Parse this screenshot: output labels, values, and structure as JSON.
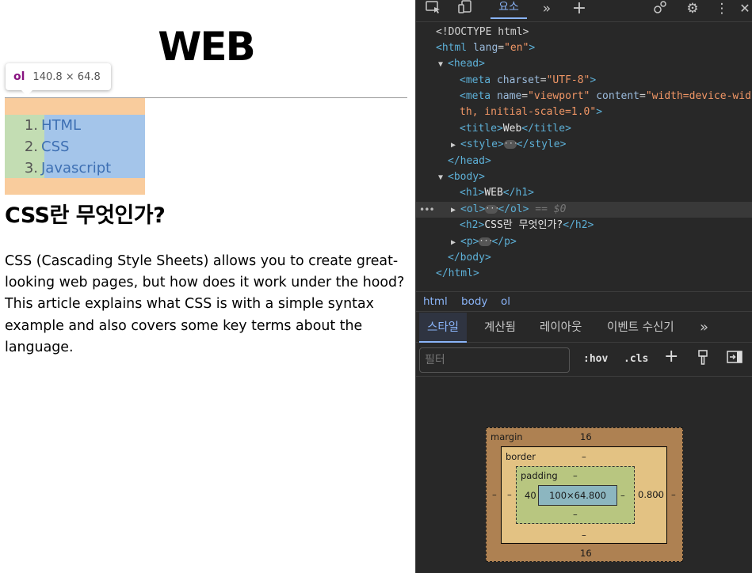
{
  "page": {
    "title": "WEB",
    "list_items": [
      {
        "num": "1.",
        "text": "HTML"
      },
      {
        "num": "2.",
        "text": "CSS"
      },
      {
        "num": "3.",
        "text": "Javascript"
      }
    ],
    "heading2": "CSS란 무엇인가?",
    "paragraph": "CSS (Cascading Style Sheets) allows you to create great-looking web pages, but how does it work under the hood? This article explains what CSS is with a simple syntax example and also covers some key terms about the language."
  },
  "tooltip": {
    "tag": "ol",
    "dimensions": "140.8 × 64.8"
  },
  "devtools": {
    "toolbar": {
      "elements_tab": "요소"
    },
    "dom": {
      "doctype": "<!DOCTYPE html>",
      "html_open": "<html",
      "html_attr_name": "lang",
      "html_attr_value": "\"en\"",
      "head_open": "<head>",
      "meta1_tag": "<meta",
      "meta1_attr": "charset",
      "meta1_val": "\"UTF-8\"",
      "meta2_tag": "<meta",
      "meta2_attr1": "name",
      "meta2_val1": "\"viewport\"",
      "meta2_attr2": "content",
      "meta2_val2a": "\"width=device-wid",
      "meta2_val2b": "th, initial-scale=1.0\"",
      "title_open": "<title>",
      "title_text": "Web",
      "title_close": "</title>",
      "style_open": "<style>",
      "style_close": "</style>",
      "head_close": "</head>",
      "body_open": "<body>",
      "h1_open": "<h1>",
      "h1_text": "WEB",
      "h1_close": "</h1>",
      "ol_open": "<ol>",
      "ol_close": "</ol>",
      "selected_marker": "== $0",
      "h2_open": "<h2>",
      "h2_text": "CSS란 무엇인가?",
      "h2_close": "</h2>",
      "p_open": "<p>",
      "p_close": "</p>",
      "body_close": "</body>",
      "html_close": "</html>"
    },
    "breadcrumb": [
      "html",
      "body",
      "ol"
    ],
    "style_tabs": [
      "스타일",
      "계산됨",
      "레이아웃",
      "이벤트 수신기"
    ],
    "filter": {
      "placeholder": "필터",
      "hov": ":hov",
      "cls": ".cls"
    },
    "box_model": {
      "margin_label": "margin",
      "margin_top": "16",
      "margin_bottom": "16",
      "margin_left": "–",
      "margin_right": "–",
      "border_label": "border",
      "border_top": "–",
      "border_bottom": "–",
      "border_left": "–",
      "border_right": "–",
      "padding_label": "padding",
      "padding_top": "–",
      "padding_bottom": "–",
      "padding_left": "40",
      "padding_right": "0.800",
      "content": "100×64.800"
    }
  }
}
